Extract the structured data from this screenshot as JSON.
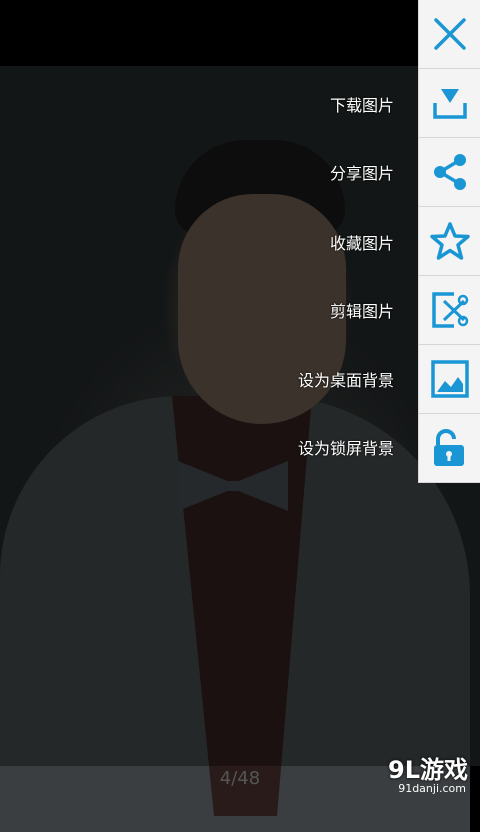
{
  "menu": {
    "items": [
      {
        "label": "下载图片",
        "icon": "download-icon"
      },
      {
        "label": "分享图片",
        "icon": "share-icon"
      },
      {
        "label": "收藏图片",
        "icon": "star-icon"
      },
      {
        "label": "剪辑图片",
        "icon": "crop-icon"
      },
      {
        "label": "设为桌面背景",
        "icon": "wallpaper-icon"
      },
      {
        "label": "设为锁屏背景",
        "icon": "lock-open-icon"
      }
    ],
    "close_icon": "close-icon",
    "accent_color": "#1a96d4"
  },
  "viewer": {
    "page_counter": "4/48"
  },
  "watermark": {
    "brand": "9L游戏",
    "site": "91danji.com"
  }
}
